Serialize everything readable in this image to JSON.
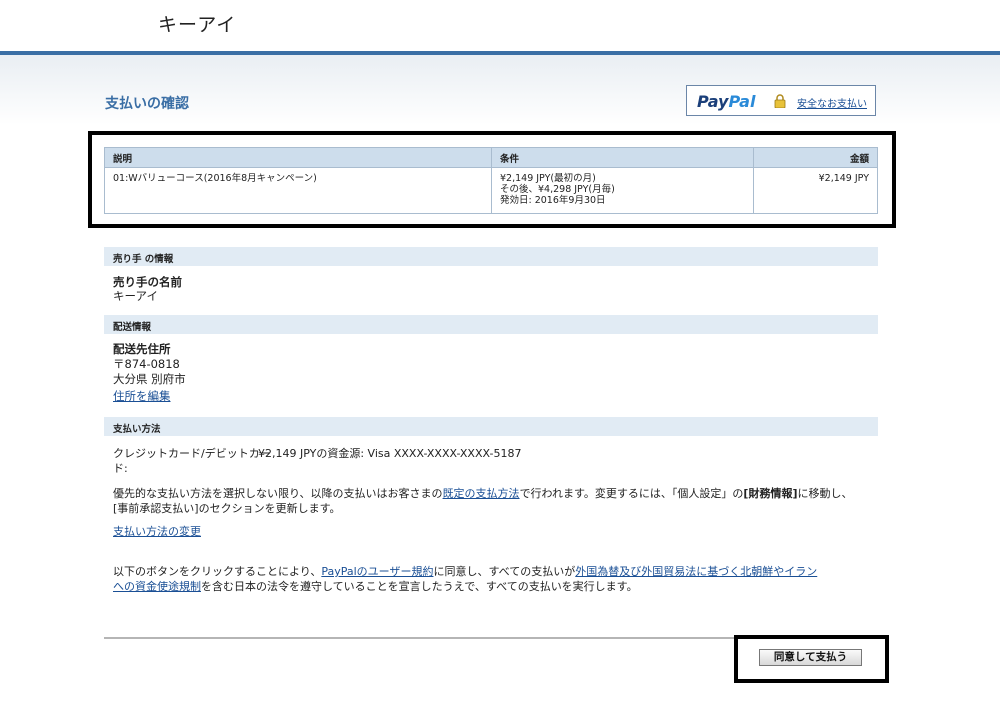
{
  "header": {
    "merchant_name": "キーアイ"
  },
  "page": {
    "title": "支払いの確認"
  },
  "paypal": {
    "logo_pay": "Pay",
    "logo_pal": "Pal",
    "secure_link": "安全なお支払い"
  },
  "items_table": {
    "headers": {
      "description": "説明",
      "terms": "条件",
      "amount": "金額"
    },
    "rows": [
      {
        "description": "01:Wバリューコース(2016年8月キャンペーン)",
        "terms_line1": "¥2,149 JPY(最初の月)",
        "terms_line2": "その後、¥4,298 JPY(月毎)",
        "terms_line3": "発効日: 2016年9月30日",
        "amount": "¥2,149 JPY"
      }
    ]
  },
  "seller_section": {
    "header": "売り手 の情報",
    "name_label": "売り手の名前",
    "name_value": "キーアイ"
  },
  "shipping_section": {
    "header": "配送情報",
    "address_label": "配送先住所",
    "postal": "〒874-0818",
    "city": "大分県 別府市",
    "edit_link": "住所を編集"
  },
  "payment_section": {
    "header": "支払い方法",
    "method_line1": "クレジットカード/デビットカー",
    "method_line2": "ド:",
    "source_text": "¥2,149 JPYの資金源: Visa XXXX-XXXX-XXXX-5187",
    "notice_part1": "優先的な支払い方法を選択しない限り、以降の支払いはお客さまの",
    "notice_link": "既定の支払方法",
    "notice_part2": "で行われます。変更するには、「個人設定」の",
    "notice_bold": "[財務情報]",
    "notice_part3": "に移動し、",
    "notice_line2": "[事前承認支払い]のセクションを更新します。",
    "change_link": "支払い方法の変更"
  },
  "legal": {
    "part1": "以下のボタンをクリックすることにより、",
    "link1": "PayPalのユーザー規約",
    "part2": "に同意し、すべての支払いが",
    "link2a": "外国為替及び外国貿易法に基づく北朝鮮やイラン",
    "link2b": "への資金使途規制",
    "part3": "を含む日本の法令を遵守していることを宣言したうえで、すべての支払いを実行します。"
  },
  "footer": {
    "agree_button": "同意して支払う"
  }
}
